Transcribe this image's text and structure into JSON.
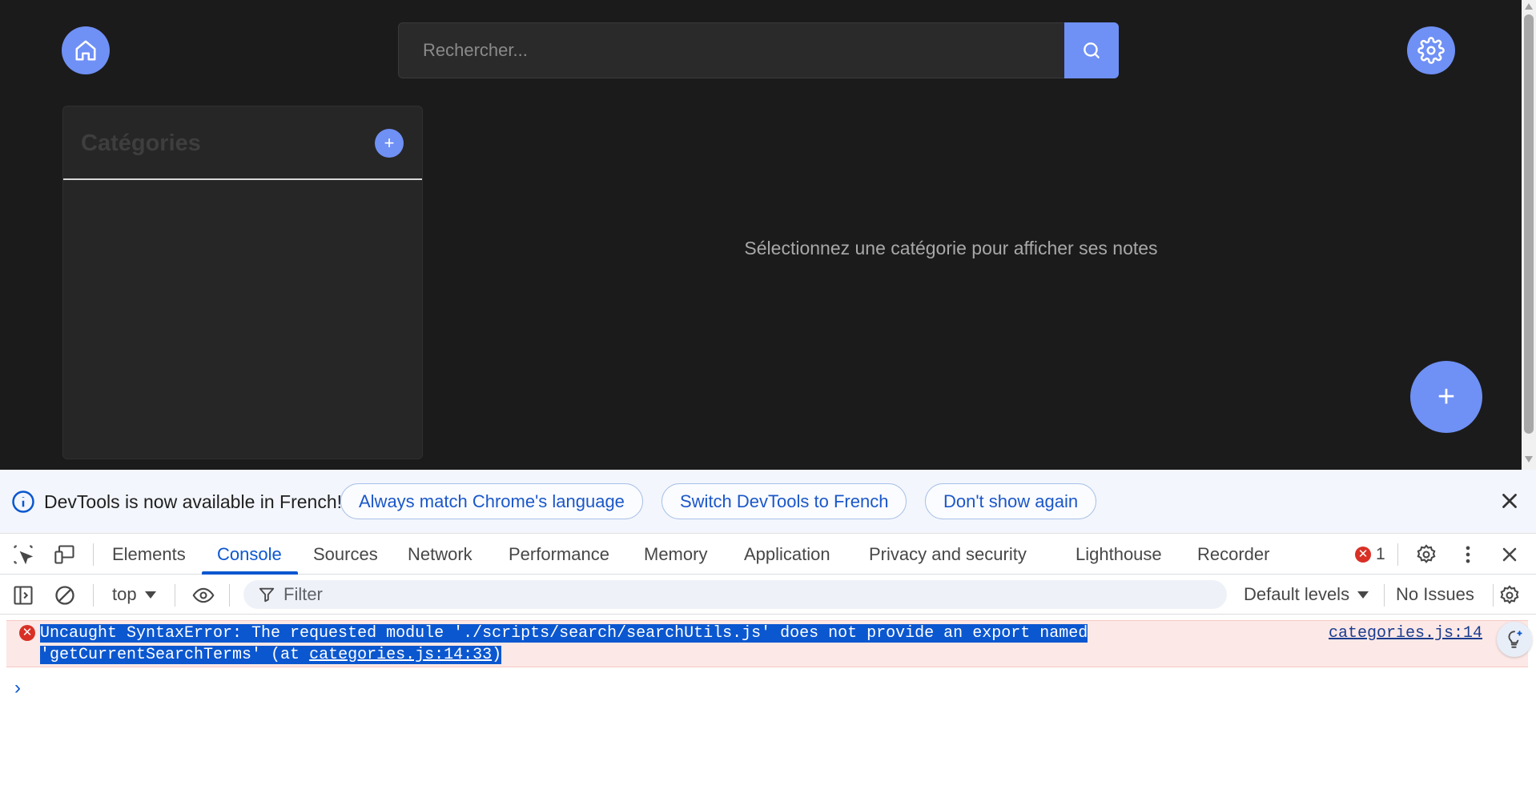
{
  "app": {
    "search_placeholder": "Rechercher...",
    "categories_title": "Catégories",
    "add_category_label": "+",
    "empty_message": "Sélectionnez une catégorie pour afficher ses notes",
    "fab_label": "+"
  },
  "devtools": {
    "lang_banner": {
      "text": "DevTools is now available in French!",
      "buttons": [
        "Always match Chrome's language",
        "Switch DevTools to French",
        "Don't show again"
      ]
    },
    "tabs": [
      "Elements",
      "Console",
      "Sources",
      "Network",
      "Performance",
      "Memory",
      "Application",
      "Privacy and security",
      "Lighthouse",
      "Recorder"
    ],
    "active_tab": "Console",
    "error_count": "1",
    "console_toolbar": {
      "context": "top",
      "filter_placeholder": "Filter",
      "levels": "Default levels",
      "issues": "No Issues"
    },
    "error": {
      "line1": "Uncaught SyntaxError: The requested module './scripts/search/searchUtils.js' does not provide an export named",
      "line2_prefix": "'getCurrentSearchTerms' (at ",
      "line2_link": "categories.js:14:33",
      "line2_suffix": ")",
      "source": "categories.js:14"
    },
    "prompt": "›"
  },
  "colors": {
    "accent": "#6f90f5",
    "app_bg": "#1b1b1b",
    "devtools_blue": "#0b57d0",
    "error_bg": "#fce8e6",
    "error_red": "#d93025"
  },
  "icons": {
    "home": "home-icon",
    "search": "search-icon",
    "settings": "gear-icon",
    "info": "info-icon",
    "close": "close-icon",
    "inspect": "inspect-element-icon",
    "device": "device-toolbar-icon",
    "sidebar": "sidebar-toggle-icon",
    "clear": "clear-console-icon",
    "eye": "eye-icon",
    "filter": "filter-icon",
    "more": "more-vert-icon",
    "ai": "ai-assistance-icon"
  }
}
